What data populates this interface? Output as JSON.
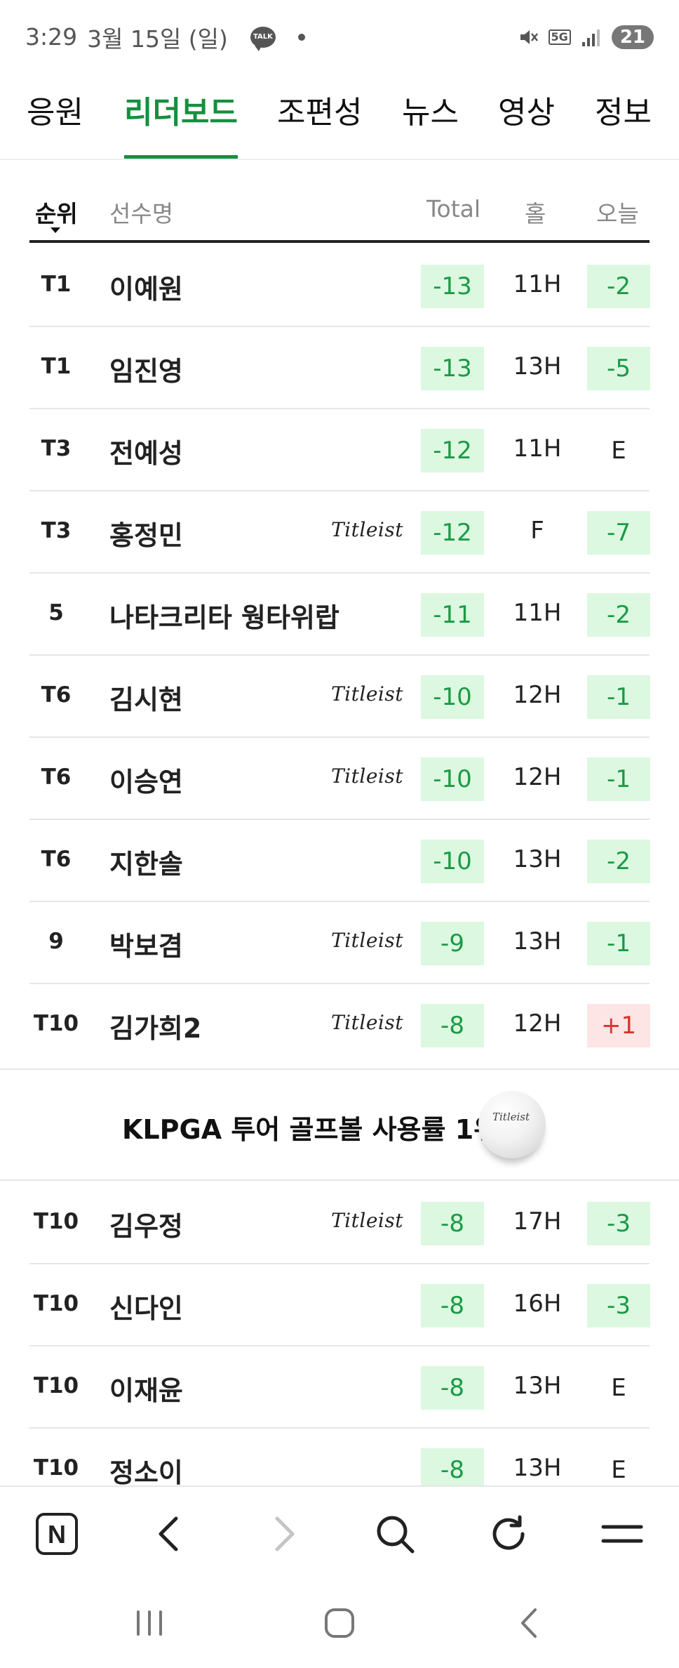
{
  "status": {
    "time": "3:29",
    "date": "3월 15일 (일)",
    "talk_label": "TALK",
    "network": "5G",
    "battery": "21"
  },
  "tabs": [
    {
      "label": "응원"
    },
    {
      "label": "리더보드",
      "active": true
    },
    {
      "label": "조편성"
    },
    {
      "label": "뉴스"
    },
    {
      "label": "영상"
    },
    {
      "label": "정보"
    }
  ],
  "table": {
    "headers": {
      "rank": "순위",
      "name": "선수명",
      "total": "Total",
      "hole": "홀",
      "today": "오늘"
    },
    "rows": [
      {
        "rank": "T1",
        "name": "이예원",
        "sponsor": "",
        "total": "-13",
        "hole": "11H",
        "today": "-2"
      },
      {
        "rank": "T1",
        "name": "임진영",
        "sponsor": "",
        "total": "-13",
        "hole": "13H",
        "today": "-5"
      },
      {
        "rank": "T3",
        "name": "전예성",
        "sponsor": "",
        "total": "-12",
        "hole": "11H",
        "today": "E"
      },
      {
        "rank": "T3",
        "name": "홍정민",
        "sponsor": "Titleist",
        "total": "-12",
        "hole": "F",
        "today": "-7"
      },
      {
        "rank": "5",
        "name": "나타크리타 웡타위랍",
        "sponsor": "",
        "total": "-11",
        "hole": "11H",
        "today": "-2"
      },
      {
        "rank": "T6",
        "name": "김시현",
        "sponsor": "Titleist",
        "total": "-10",
        "hole": "12H",
        "today": "-1"
      },
      {
        "rank": "T6",
        "name": "이승연",
        "sponsor": "Titleist",
        "total": "-10",
        "hole": "12H",
        "today": "-1"
      },
      {
        "rank": "T6",
        "name": "지한솔",
        "sponsor": "",
        "total": "-10",
        "hole": "13H",
        "today": "-2"
      },
      {
        "rank": "9",
        "name": "박보겸",
        "sponsor": "Titleist",
        "total": "-9",
        "hole": "13H",
        "today": "-1"
      },
      {
        "rank": "T10",
        "name": "김가희2",
        "sponsor": "Titleist",
        "total": "-8",
        "hole": "12H",
        "today": "+1"
      }
    ],
    "rows_after_banner": [
      {
        "rank": "T10",
        "name": "김우정",
        "sponsor": "Titleist",
        "total": "-8",
        "hole": "17H",
        "today": "-3"
      },
      {
        "rank": "T10",
        "name": "신다인",
        "sponsor": "",
        "total": "-8",
        "hole": "16H",
        "today": "-3"
      },
      {
        "rank": "T10",
        "name": "이재윤",
        "sponsor": "",
        "total": "-8",
        "hole": "13H",
        "today": "E"
      },
      {
        "rank": "T10",
        "name": "정소이",
        "sponsor": "",
        "total": "-8",
        "hole": "13H",
        "today": "E"
      }
    ]
  },
  "banner": {
    "text": "KLPGA 투어 골프볼 사용률 1위",
    "ball_mark": "Titleist"
  },
  "browser_bar": {
    "icons": [
      "naver-n-icon",
      "back-arrow-icon",
      "forward-arrow-icon",
      "search-icon",
      "refresh-icon",
      "menu-icon"
    ],
    "home_letter": "N"
  },
  "system_nav": {
    "icons": [
      "recent-apps-icon",
      "home-icon",
      "back-icon"
    ]
  },
  "colors": {
    "accent": "#14903f",
    "under_par_bg": "#dcf8e0",
    "under_par_text": "#1c9a46",
    "over_par_bg": "#fde5e5",
    "over_par_text": "#d9342b"
  }
}
